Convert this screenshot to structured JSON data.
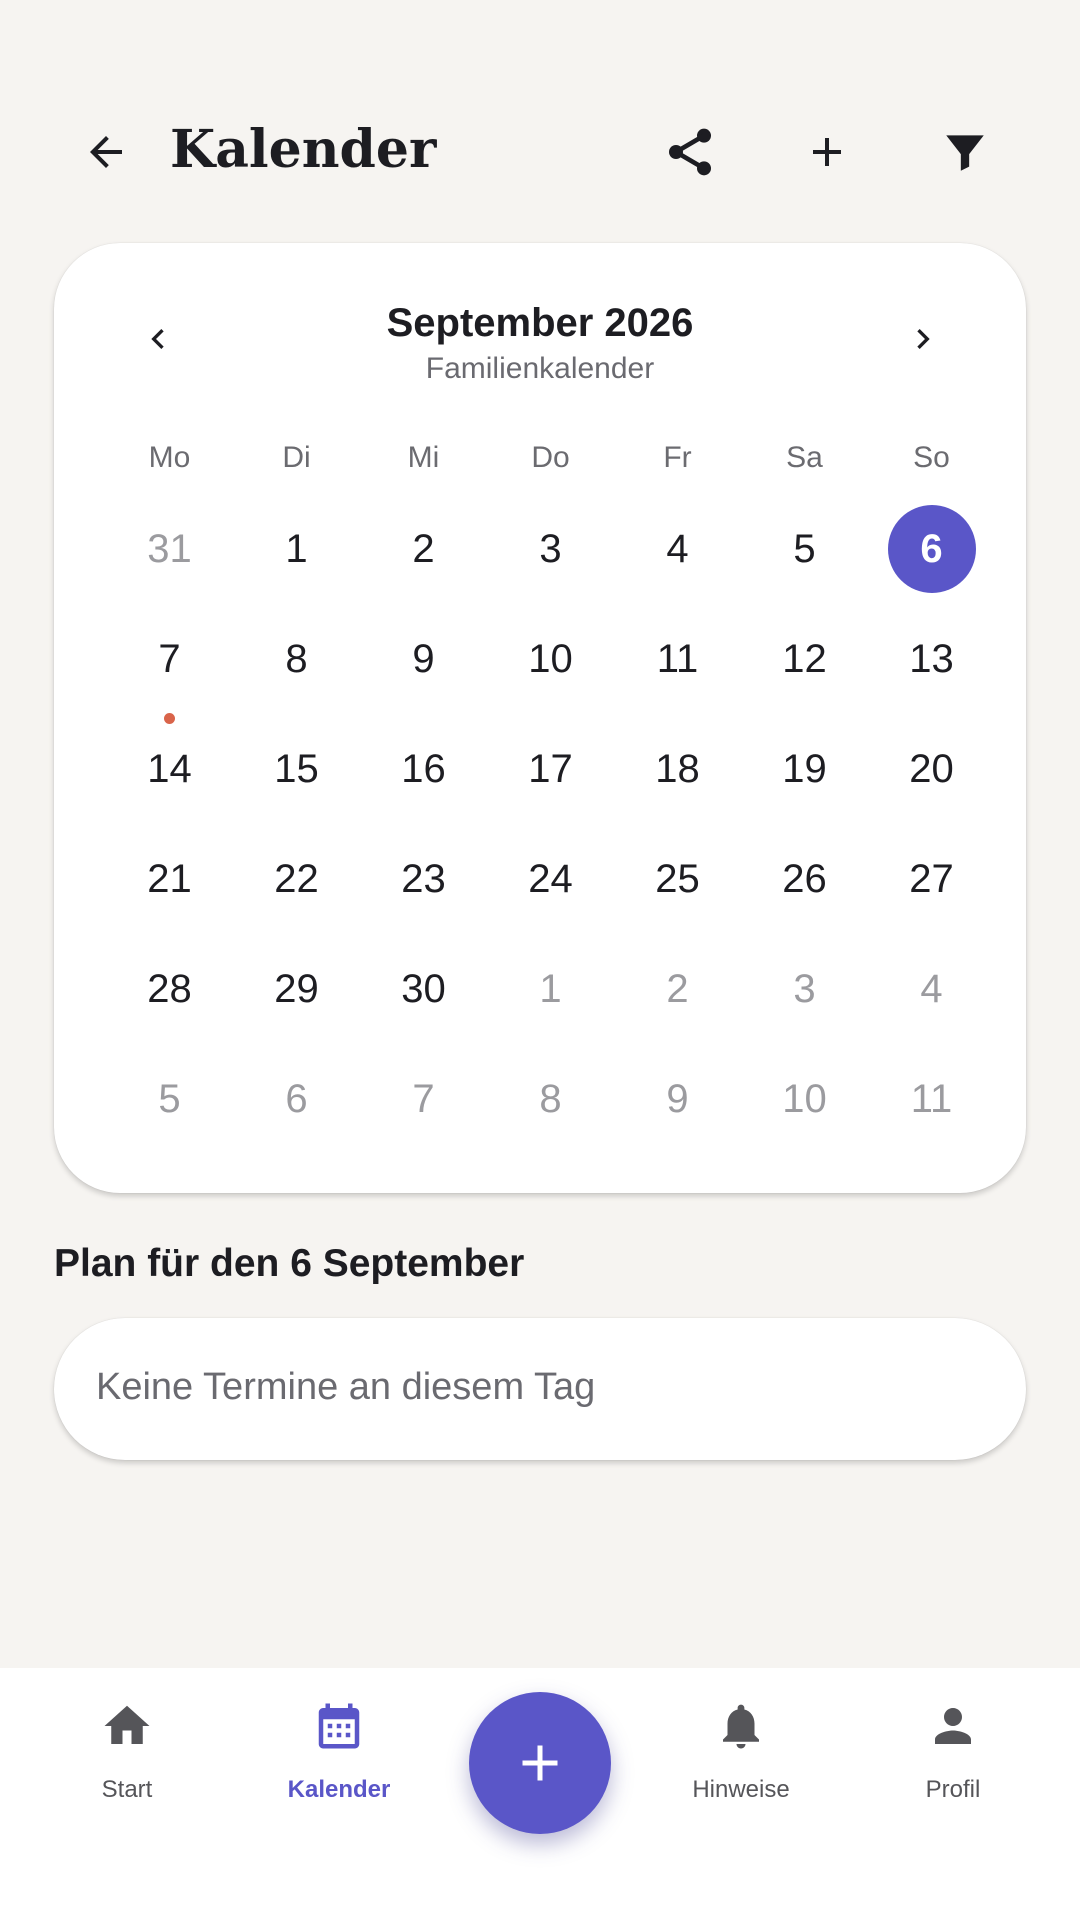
{
  "header": {
    "title": "Kalender",
    "icons": [
      "arrow-left-icon",
      "share-icon",
      "plus-icon",
      "filter-icon"
    ]
  },
  "calendar": {
    "month_label": "September 2026",
    "subtitle": "Familienkalender",
    "weekdays": [
      "Mo",
      "Di",
      "Mi",
      "Do",
      "Fr",
      "Sa",
      "So"
    ],
    "days": [
      {
        "label": "31",
        "other": true
      },
      {
        "label": "1"
      },
      {
        "label": "2"
      },
      {
        "label": "3"
      },
      {
        "label": "4"
      },
      {
        "label": "5"
      },
      {
        "label": "6",
        "selected": true
      },
      {
        "label": "7",
        "event": true
      },
      {
        "label": "8"
      },
      {
        "label": "9"
      },
      {
        "label": "10"
      },
      {
        "label": "11"
      },
      {
        "label": "12"
      },
      {
        "label": "13"
      },
      {
        "label": "14"
      },
      {
        "label": "15"
      },
      {
        "label": "16"
      },
      {
        "label": "17"
      },
      {
        "label": "18"
      },
      {
        "label": "19"
      },
      {
        "label": "20"
      },
      {
        "label": "21"
      },
      {
        "label": "22"
      },
      {
        "label": "23"
      },
      {
        "label": "24"
      },
      {
        "label": "25"
      },
      {
        "label": "26"
      },
      {
        "label": "27"
      },
      {
        "label": "28"
      },
      {
        "label": "29"
      },
      {
        "label": "30"
      },
      {
        "label": "1",
        "other": true
      },
      {
        "label": "2",
        "other": true
      },
      {
        "label": "3",
        "other": true
      },
      {
        "label": "4",
        "other": true
      },
      {
        "label": "5",
        "other": true
      },
      {
        "label": "6",
        "other": true
      },
      {
        "label": "7",
        "other": true
      },
      {
        "label": "8",
        "other": true
      },
      {
        "label": "9",
        "other": true
      },
      {
        "label": "10",
        "other": true
      },
      {
        "label": "11",
        "other": true
      }
    ],
    "colors": {
      "accent": "#5a56c8",
      "event_dot": "#d9644a",
      "muted": "#9b9b9f"
    }
  },
  "plan": {
    "title": "Plan für den 6 September",
    "empty_text": "Keine Termine an diesem Tag"
  },
  "bottom_nav": {
    "items": [
      {
        "label": "Start",
        "icon": "home-icon"
      },
      {
        "label": "Kalender",
        "icon": "calendar-icon",
        "active": true
      },
      {
        "label": "Hinweise",
        "icon": "bell-icon"
      },
      {
        "label": "Profil",
        "icon": "person-icon"
      }
    ],
    "fab_icon": "plus-icon"
  }
}
